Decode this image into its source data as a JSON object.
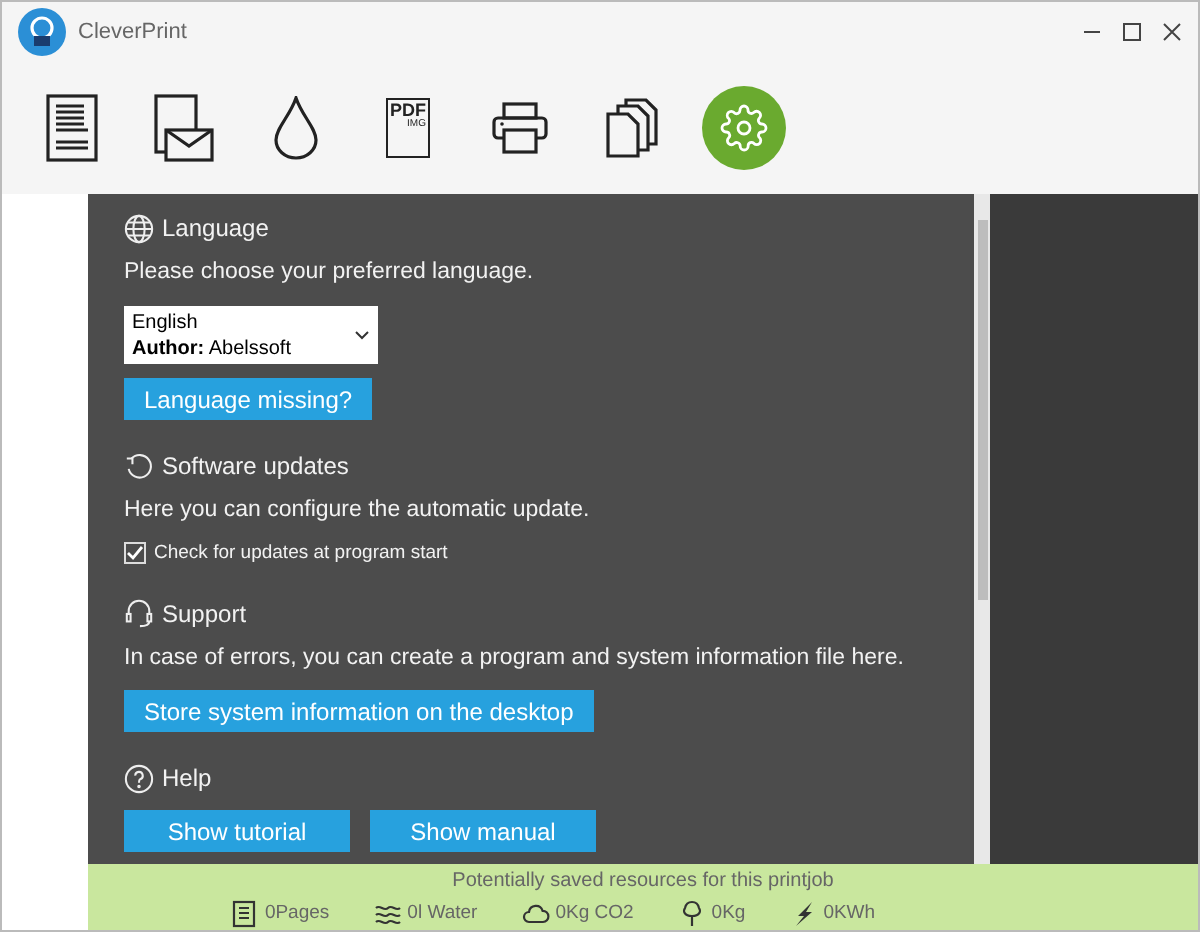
{
  "window": {
    "title": "CleverPrint"
  },
  "toolbar": [
    {
      "kind": "document",
      "selected": false
    },
    {
      "kind": "mail",
      "selected": false
    },
    {
      "kind": "drop",
      "selected": false
    },
    {
      "kind": "pdf",
      "label": "PDF",
      "sublabel": "IMG",
      "selected": false
    },
    {
      "kind": "printer",
      "selected": false
    },
    {
      "kind": "copies",
      "selected": false
    },
    {
      "kind": "settings",
      "selected": true
    }
  ],
  "sections": [
    {
      "kind": "language",
      "title": "Language",
      "description": "Please choose your preferred language.",
      "dropdown": {
        "value": "English",
        "author_label": "Author:",
        "author": "Abelssoft"
      },
      "buttons": [
        "Language missing?"
      ]
    },
    {
      "kind": "updates",
      "title": "Software updates",
      "description": "Here you can configure the automatic update.",
      "checkbox": {
        "label": "Check for updates at program start",
        "checked": true
      }
    },
    {
      "kind": "support",
      "title": "Support",
      "description": "In case of errors, you can create a program and system information file here.",
      "buttons": [
        "Store system information on the desktop"
      ]
    },
    {
      "kind": "help",
      "title": "Help",
      "buttons": [
        "Show tutorial",
        "Show manual"
      ]
    }
  ],
  "savings": {
    "title": "Potentially saved resources for this printjob",
    "items": [
      {
        "kind": "pages",
        "text": "0Pages"
      },
      {
        "kind": "water",
        "text": "0l Water"
      },
      {
        "kind": "co2",
        "text": "0Kg CO2"
      },
      {
        "kind": "tree",
        "text": "0Kg"
      },
      {
        "kind": "energy",
        "text": "0KWh"
      }
    ]
  }
}
